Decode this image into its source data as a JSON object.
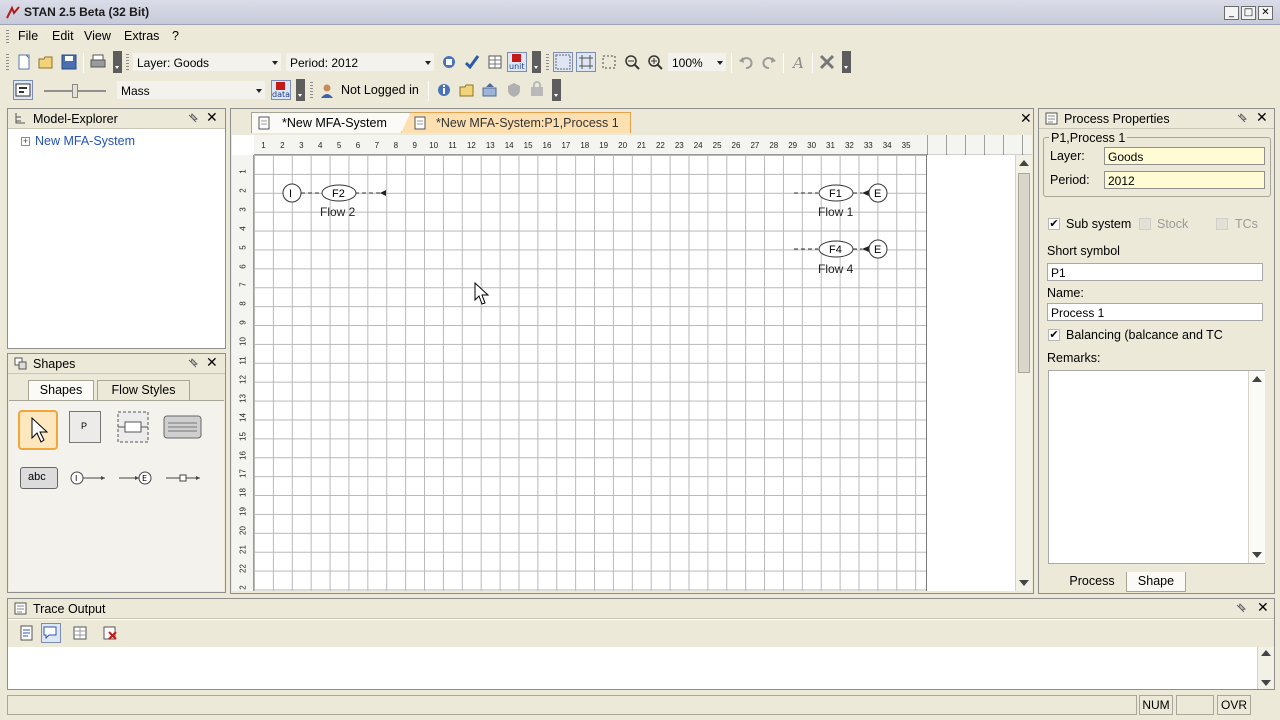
{
  "window": {
    "title": "STAN 2.5 Beta (32 Bit)",
    "btn_min": "_",
    "btn_max": "□",
    "btn_close": "✕"
  },
  "menu": {
    "file": "File",
    "edit": "Edit",
    "view": "View",
    "extras": "Extras",
    "help": "?"
  },
  "toolbar1": {
    "layer": "Layer: Goods",
    "period": "Period: 2012",
    "zoom": "100%",
    "unit_label": "unit"
  },
  "toolbar2": {
    "quantity": "Mass",
    "login": "Not Logged in",
    "data_label": "data"
  },
  "explorer": {
    "title": "Model-Explorer",
    "root": "New MFA-System",
    "pin": "pin",
    "close": "✕"
  },
  "shapes": {
    "title": "Shapes",
    "close": "✕",
    "tabs": [
      "Shapes",
      "Flow Styles"
    ],
    "process_tile": "P",
    "text_tile": "abc",
    "import_tile": "I",
    "export_tile": "E"
  },
  "editor": {
    "tabs": [
      "*New MFA-System",
      "*New MFA-System:P1,Process 1"
    ],
    "close": "✕",
    "ruler_h": [
      "1",
      "2",
      "3",
      "4",
      "5",
      "6",
      "7",
      "8",
      "9",
      "10",
      "11",
      "12",
      "13",
      "14",
      "15",
      "16",
      "17",
      "18",
      "19",
      "20",
      "21",
      "22",
      "23",
      "24",
      "25",
      "26",
      "27",
      "28",
      "29",
      "30",
      "31",
      "32",
      "33",
      "34",
      "35"
    ],
    "ruler_v": [
      "1",
      "2",
      "3",
      "4",
      "5",
      "6",
      "7",
      "8",
      "9",
      "10",
      "11",
      "12",
      "13",
      "14",
      "15",
      "16",
      "17",
      "18",
      "19",
      "20",
      "21",
      "22",
      "2"
    ],
    "diagram": {
      "import_node": "I",
      "flow_f2": "F2",
      "flow_f2_label": "Flow 2",
      "flow_f1": "F1",
      "flow_f1_label": "Flow 1",
      "flow_f4": "F4",
      "flow_f4_label": "Flow 4",
      "export1": "E",
      "export2": "E"
    }
  },
  "properties": {
    "title": "Process Properties",
    "close": "✕",
    "group": "P1,Process 1",
    "layer_label": "Layer:",
    "layer_value": "Goods",
    "period_label": "Period:",
    "period_value": "2012",
    "subsystem": "Sub system",
    "stock": "Stock",
    "tcs": "TCs",
    "short_symbol_label": "Short symbol",
    "short_symbol_value": "P1",
    "name_label": "Name:",
    "name_value": "Process 1",
    "balancing": "Balancing (balcance and TC",
    "remarks_label": "Remarks:",
    "tabs": [
      "Process",
      "Shape"
    ],
    "check": "✔"
  },
  "trace": {
    "title": "Trace Output",
    "close": "✕"
  },
  "status": {
    "num": "NUM",
    "ovr": "OVR"
  }
}
